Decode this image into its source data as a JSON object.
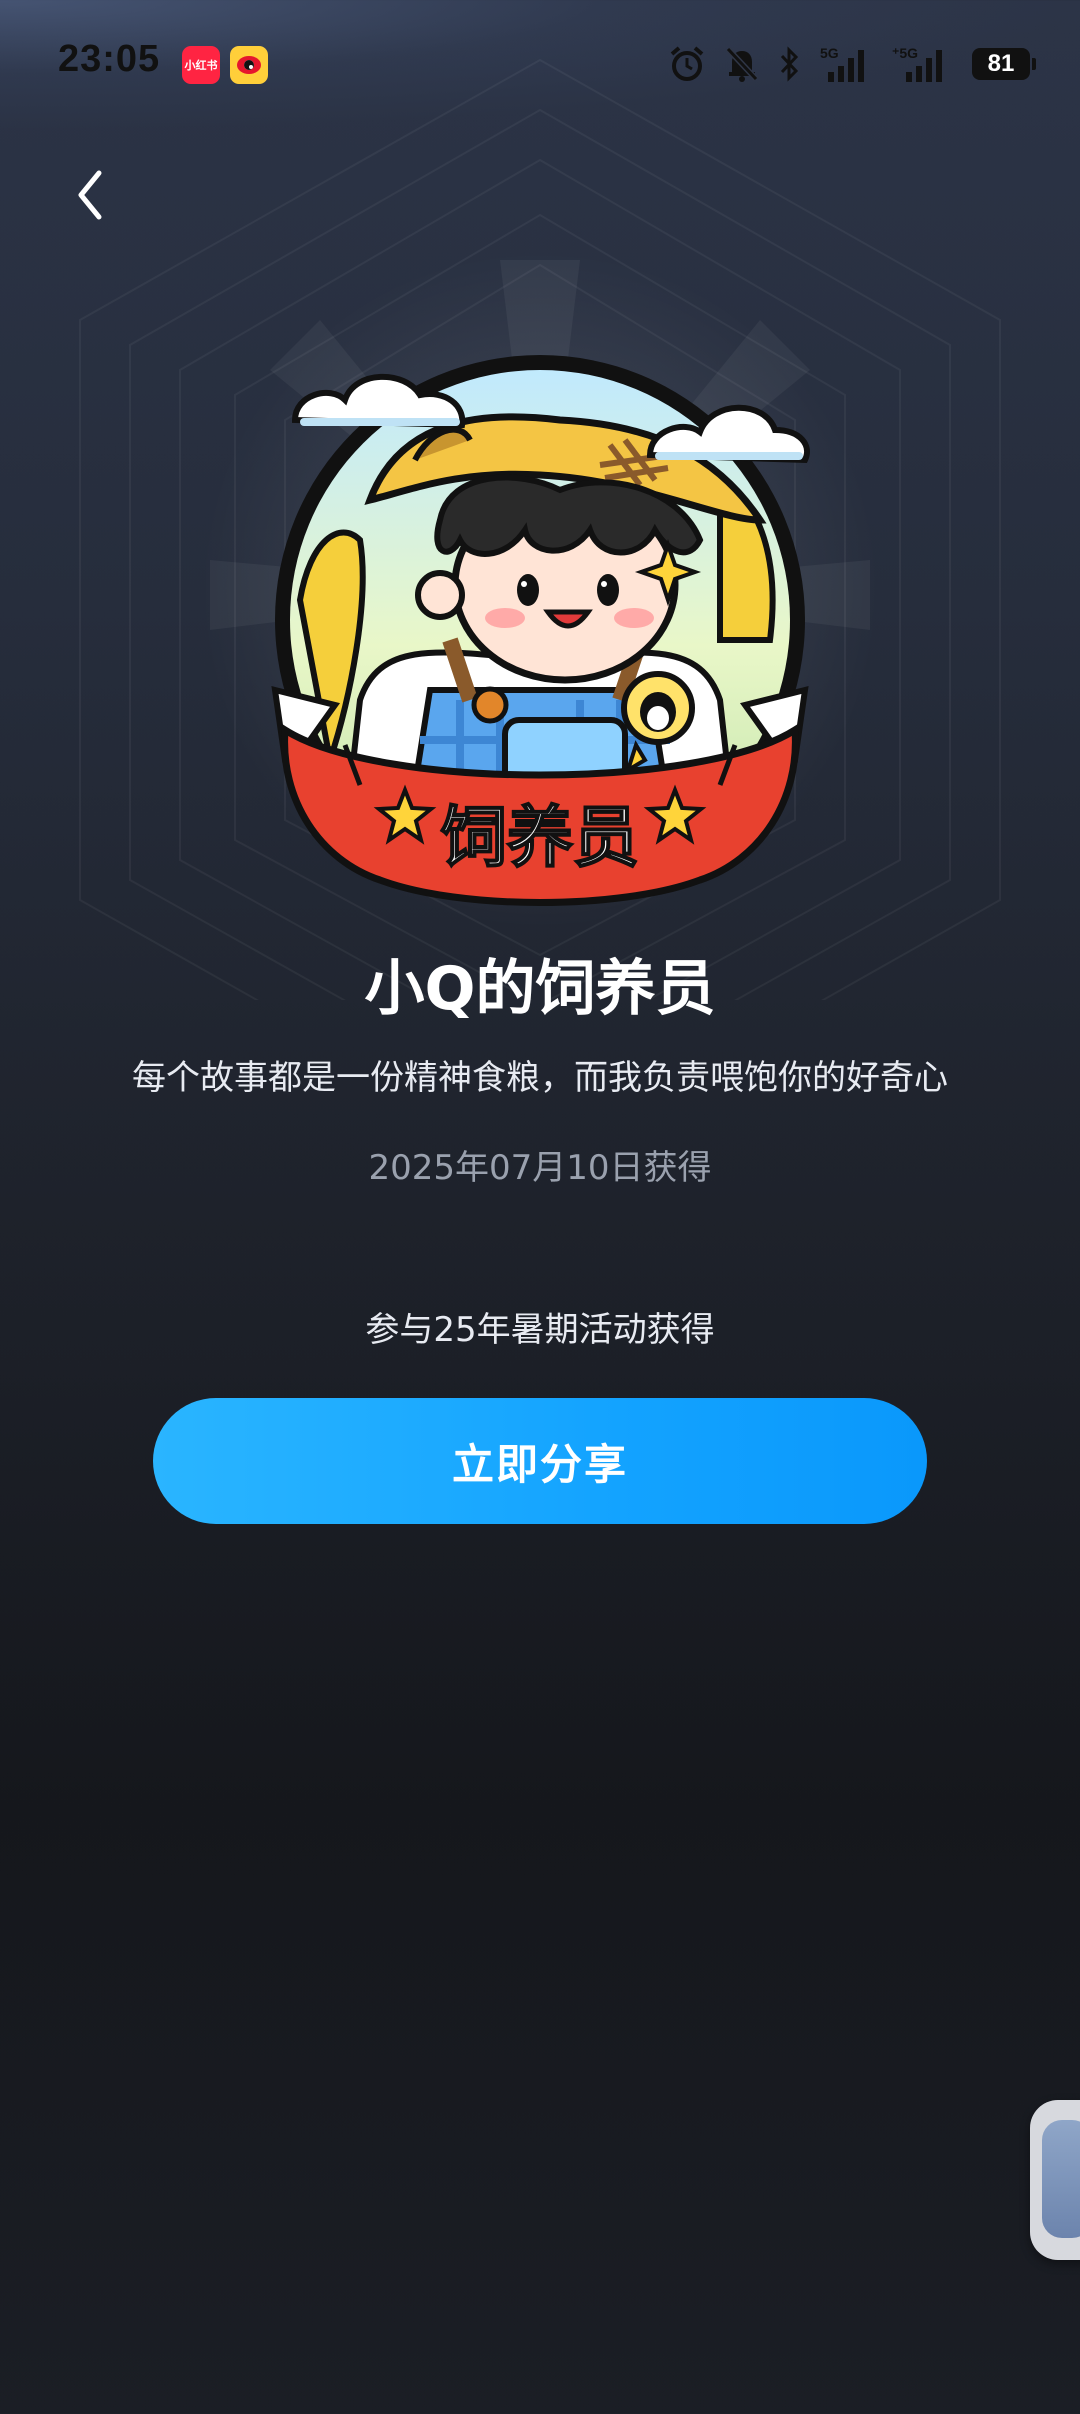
{
  "status_bar": {
    "time": "23:05",
    "apps": [
      "小红书",
      "weibo"
    ],
    "network_1": "5G",
    "network_2": "5G",
    "battery": "81",
    "icons": [
      "alarm-icon",
      "mute-bell-icon",
      "bluetooth-icon",
      "signal-5g-icon",
      "signal-5g-icon",
      "battery-icon"
    ]
  },
  "nav": {
    "back_icon": "chevron-left-icon"
  },
  "badge": {
    "ribbon_text": "饲养员",
    "title": "小Q的饲养员",
    "description": "每个故事都是一份精神食粮，而我负责喂饱你的好奇心",
    "date": "2025年07月10日获得",
    "source": "参与25年暑期活动获得"
  },
  "actions": {
    "share_label": "立即分享"
  },
  "colors": {
    "accent": "#13a3ff",
    "ribbon": "#e8412f",
    "background_top": "#2c3447",
    "background_bottom": "#15171c"
  }
}
